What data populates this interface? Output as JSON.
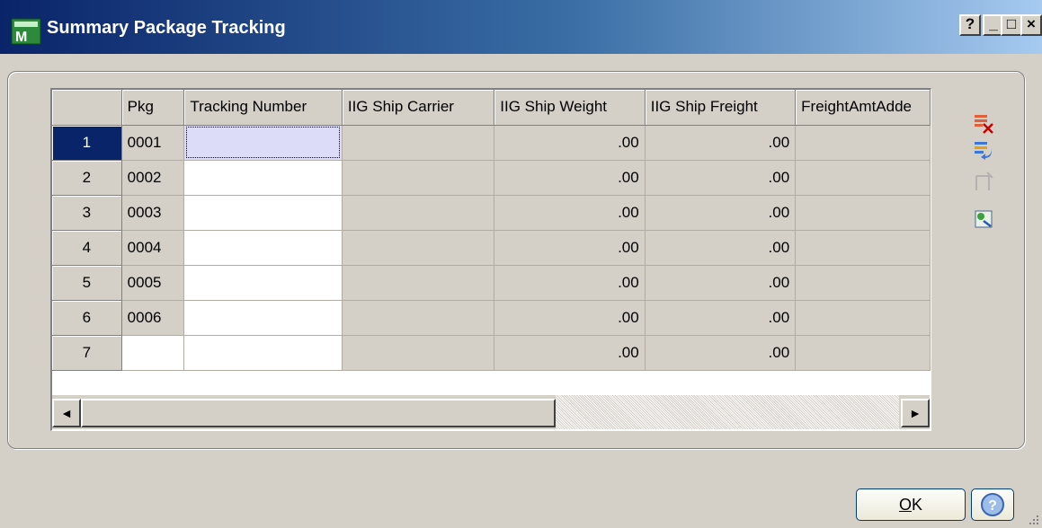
{
  "window": {
    "title": "Summary Package Tracking",
    "caption_buttons": [
      "?",
      "_",
      "□",
      "×"
    ]
  },
  "grid": {
    "columns": [
      "",
      "Pkg",
      "Tracking Number",
      "IIG Ship Carrier",
      "IIG Ship Weight",
      "IIG Ship Freight",
      "FreightAmtAdde"
    ],
    "rows": [
      {
        "row": "1",
        "pkg": "0001",
        "tracking": "",
        "carrier": "",
        "weight": ".00",
        "freight": ".00",
        "freight_added": ""
      },
      {
        "row": "2",
        "pkg": "0002",
        "tracking": "",
        "carrier": "",
        "weight": ".00",
        "freight": ".00",
        "freight_added": ""
      },
      {
        "row": "3",
        "pkg": "0003",
        "tracking": "",
        "carrier": "",
        "weight": ".00",
        "freight": ".00",
        "freight_added": ""
      },
      {
        "row": "4",
        "pkg": "0004",
        "tracking": "",
        "carrier": "",
        "weight": ".00",
        "freight": ".00",
        "freight_added": ""
      },
      {
        "row": "5",
        "pkg": "0005",
        "tracking": "",
        "carrier": "",
        "weight": ".00",
        "freight": ".00",
        "freight_added": ""
      },
      {
        "row": "6",
        "pkg": "0006",
        "tracking": "",
        "carrier": "",
        "weight": ".00",
        "freight": ".00",
        "freight_added": ""
      },
      {
        "row": "7",
        "pkg": "",
        "tracking": "",
        "carrier": "",
        "weight": ".00",
        "freight": ".00",
        "freight_added": ""
      }
    ],
    "selected_row": "1"
  },
  "scrollbar": {
    "left_arrow": "◄",
    "right_arrow": "►"
  },
  "toolbar": {
    "icons": [
      "delete-row-icon",
      "insert-row-icon",
      "clear-icon",
      "lookup-icon"
    ]
  },
  "buttons": {
    "ok_label": "OK",
    "help_label": "?"
  },
  "colors": {
    "title_start": "#0a246a",
    "title_end": "#a6caf0",
    "selection": "#0a246a",
    "focus_cell": "#dcdcf8"
  }
}
